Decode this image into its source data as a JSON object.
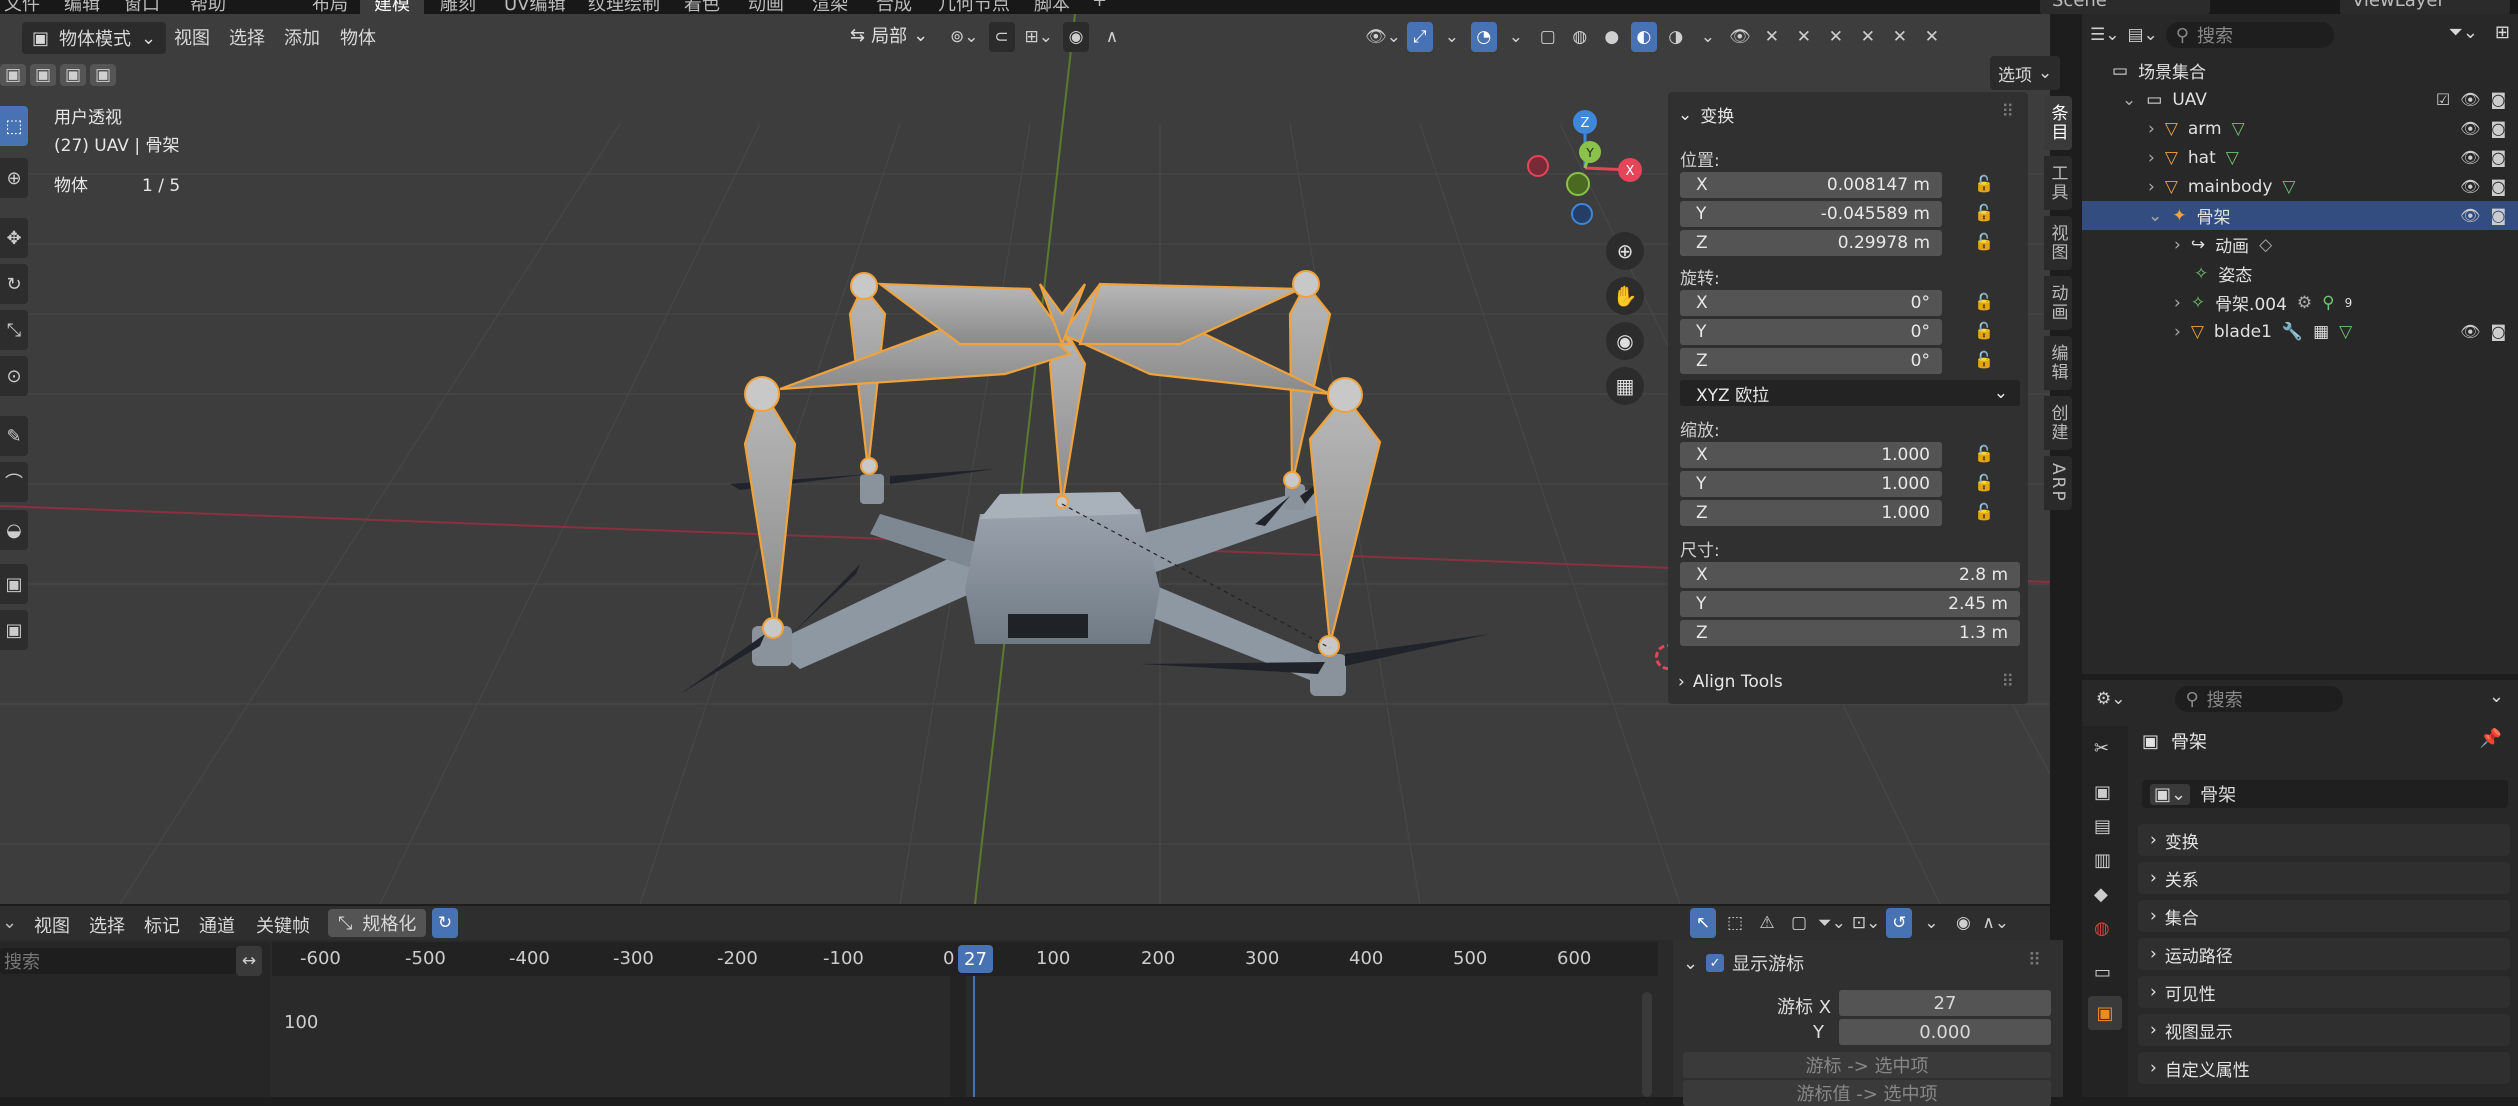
{
  "topbar": {
    "left_menus": [
      "文件",
      "编辑",
      "窗口",
      "帮助"
    ],
    "workspace_tabs": [
      "布局",
      "建模",
      "雕刻",
      "UV编辑",
      "纹理绘制",
      "着色",
      "动画",
      "渲染",
      "合成",
      "几何节点",
      "脚本",
      "+"
    ],
    "active_tab": "建模",
    "scene": "Scene",
    "view_layer": "ViewLayer"
  },
  "viewport_header": {
    "mode": "物体模式",
    "menus": [
      "视图",
      "选择",
      "添加",
      "物体"
    ],
    "transform_orientation": "局部",
    "options_label": "选项"
  },
  "viewport": {
    "overlay_lines": [
      "用户透视",
      "(27) UAV | 骨架"
    ],
    "objects_label": "物体",
    "objects_count": "1 / 5",
    "gizmo": {
      "x": "X",
      "y": "Y",
      "z": "Z"
    },
    "colors": {
      "x_axis": "#e64458",
      "y_axis": "#8bc34a",
      "z_axis": "#3f87d9",
      "bone_outline": "#f0a23c"
    }
  },
  "npanel": {
    "section": "变换",
    "location_label": "位置:",
    "location": [
      {
        "axis": "X",
        "value": "0.008147 m"
      },
      {
        "axis": "Y",
        "value": "-0.045589 m"
      },
      {
        "axis": "Z",
        "value": "0.29978 m"
      }
    ],
    "rotation_label": "旋转:",
    "rotation": [
      {
        "axis": "X",
        "value": "0°"
      },
      {
        "axis": "Y",
        "value": "0°"
      },
      {
        "axis": "Z",
        "value": "0°"
      }
    ],
    "rotation_mode": "XYZ 欧拉",
    "scale_label": "缩放:",
    "scale": [
      {
        "axis": "X",
        "value": "1.000"
      },
      {
        "axis": "Y",
        "value": "1.000"
      },
      {
        "axis": "Z",
        "value": "1.000"
      }
    ],
    "dimensions_label": "尺寸:",
    "dimensions": [
      {
        "axis": "X",
        "value": "2.8 m"
      },
      {
        "axis": "Y",
        "value": "2.45 m"
      },
      {
        "axis": "Z",
        "value": "1.3 m"
      }
    ],
    "align_tools": "Align Tools",
    "tabs": [
      "条目",
      "工具",
      "视图",
      "动画",
      "编辑",
      "创建",
      "ARP"
    ]
  },
  "outliner": {
    "search_placeholder": "搜索",
    "root": "场景集合",
    "items": [
      {
        "name": "UAV",
        "depth": 1
      },
      {
        "name": "arm",
        "depth": 2
      },
      {
        "name": "hat",
        "depth": 2
      },
      {
        "name": "mainbody",
        "depth": 2
      },
      {
        "name": "骨架",
        "depth": 2,
        "selected": true
      },
      {
        "name": "动画",
        "depth": 3
      },
      {
        "name": "姿态",
        "depth": 3
      },
      {
        "name": "骨架.004",
        "depth": 3,
        "badge": "9"
      },
      {
        "name": "blade1",
        "depth": 3
      }
    ]
  },
  "properties": {
    "search_placeholder": "搜索",
    "object_name": "骨架",
    "data_name": "骨架",
    "sections": [
      "变换",
      "关系",
      "集合",
      "运动路径",
      "可见性",
      "视图显示",
      "自定义属性"
    ]
  },
  "timeline": {
    "menus": [
      "视图",
      "选择",
      "标记",
      "通道",
      "关键帧"
    ],
    "normalize": "规格化",
    "search_placeholder": "搜索",
    "ruler": [
      "-600",
      "-500",
      "-400",
      "-300",
      "-200",
      "-100",
      "0",
      "100",
      "200",
      "300",
      "400",
      "500",
      "600"
    ],
    "current_frame": "27",
    "y_label": "100",
    "show_cursor": "显示游标",
    "cursor_x_label": "游标 X",
    "cursor_x": "27",
    "cursor_y_label": "Y",
    "cursor_y": "0.000",
    "btn_cursor_to_selected": "游标 -> 选中项",
    "btn_cursor_value": "游标值 -> 选中项"
  }
}
